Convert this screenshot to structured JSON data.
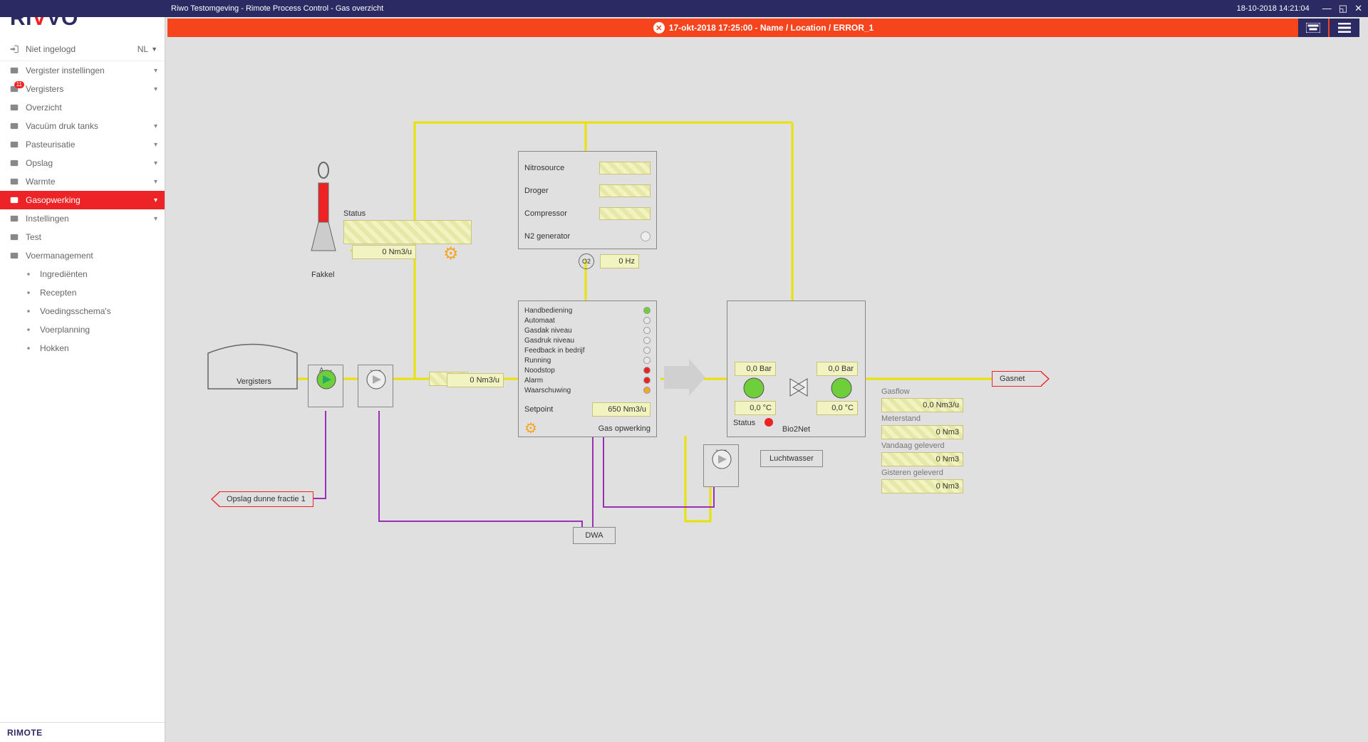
{
  "titlebar": {
    "text": "Riwo Testomgeving - Rimote Process Control - Gas overzicht",
    "datetime": "18-10-2018 14:21:04"
  },
  "alert": {
    "text": "17-okt-2018 17:25:00  - Name / Location / ERROR_1"
  },
  "logo": {
    "p1": "RI",
    "p2": "V",
    "p3": "VO"
  },
  "user": {
    "status": "Niet ingelogd",
    "lang": "NL"
  },
  "menu": [
    {
      "label": "Vergister instellingen",
      "chev": true
    },
    {
      "label": "Vergisters",
      "chev": true,
      "badge": "11"
    },
    {
      "label": "Overzicht"
    },
    {
      "label": "Vacuüm druk tanks",
      "chev": true
    },
    {
      "label": "Pasteurisatie",
      "chev": true
    },
    {
      "label": "Opslag",
      "chev": true
    },
    {
      "label": "Warmte",
      "chev": true
    },
    {
      "label": "Gasopwerking",
      "chev": true,
      "active": true
    },
    {
      "label": "Instellingen",
      "chev": true
    },
    {
      "label": "Test"
    },
    {
      "label": "Voermanagement"
    },
    {
      "label": "Ingrediënten",
      "sub": true
    },
    {
      "label": "Recepten",
      "sub": true
    },
    {
      "label": "Voedingsschema's",
      "sub": true
    },
    {
      "label": "Voerplanning",
      "sub": true
    },
    {
      "label": "Hokken",
      "sub": true
    }
  ],
  "footer": "RIMOTE",
  "fakkel": {
    "label": "Fakkel",
    "status_label": "Status",
    "flow": "0  Nm3/u"
  },
  "sysbox": {
    "nitrosource": "Nitrosource",
    "droger": "Droger",
    "compressor": "Compressor",
    "n2": "N2 generator"
  },
  "o2": {
    "label": "O2",
    "hz": "0  Hz"
  },
  "vergisters": {
    "label": "Vergisters",
    "flow": "0  Nm3/u",
    "pump_label": "A   -   -",
    "pump2_label": "-   -   -"
  },
  "gasopw": {
    "title": "Gas opwerking",
    "items": [
      "Handbediening",
      "Automaat",
      "Gasdak niveau",
      "Gasdruk niveau",
      "Feedback in bedrijf",
      "Running",
      "Noodstop",
      "Alarm",
      "Waarschuwing"
    ],
    "colors": [
      "#6ecf3a",
      "#e8e8e8",
      "#e8e8e8",
      "#e8e8e8",
      "#e8e8e8",
      "#e8e8e8",
      "#e22",
      "#e22",
      "#f5a623"
    ],
    "setpoint_label": "Setpoint",
    "setpoint": "650  Nm3/u"
  },
  "bio2net": {
    "title": "Bio2Net",
    "bar1": "0,0  Bar",
    "bar2": "0,0  Bar",
    "c1": "0,0  °C",
    "c2": "0,0  °C",
    "status_label": "Status"
  },
  "luchtwasser": {
    "label": "Luchtwasser",
    "pump_label": "-   -   -"
  },
  "gasnet": "Gasnet",
  "opslag": "Opslag dunne fractie 1",
  "dwa": "DWA",
  "readings": {
    "gasflow_label": "Gasflow",
    "gasflow": "0,0  Nm3/u",
    "meterstand_label": "Meterstand",
    "meterstand": "0  Nm3",
    "vandaag_label": "Vandaag geleverd",
    "vandaag": "0  Nm3",
    "gisteren_label": "Gisteren geleverd",
    "gisteren": "0  Nm3"
  }
}
